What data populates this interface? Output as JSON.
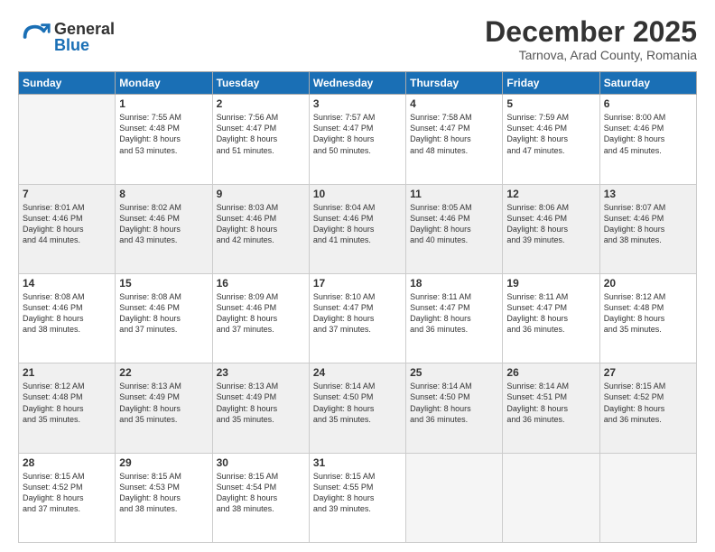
{
  "logo": {
    "general": "General",
    "blue": "Blue"
  },
  "title": "December 2025",
  "location": "Tarnova, Arad County, Romania",
  "weekdays": [
    "Sunday",
    "Monday",
    "Tuesday",
    "Wednesday",
    "Thursday",
    "Friday",
    "Saturday"
  ],
  "weeks": [
    [
      {
        "day": "",
        "empty": true
      },
      {
        "day": "1",
        "sunrise": "7:55 AM",
        "sunset": "4:48 PM",
        "daylight": "8 hours and 53 minutes."
      },
      {
        "day": "2",
        "sunrise": "7:56 AM",
        "sunset": "4:47 PM",
        "daylight": "8 hours and 51 minutes."
      },
      {
        "day": "3",
        "sunrise": "7:57 AM",
        "sunset": "4:47 PM",
        "daylight": "8 hours and 50 minutes."
      },
      {
        "day": "4",
        "sunrise": "7:58 AM",
        "sunset": "4:47 PM",
        "daylight": "8 hours and 48 minutes."
      },
      {
        "day": "5",
        "sunrise": "7:59 AM",
        "sunset": "4:46 PM",
        "daylight": "8 hours and 47 minutes."
      },
      {
        "day": "6",
        "sunrise": "8:00 AM",
        "sunset": "4:46 PM",
        "daylight": "8 hours and 45 minutes."
      }
    ],
    [
      {
        "day": "7",
        "sunrise": "8:01 AM",
        "sunset": "4:46 PM",
        "daylight": "8 hours and 44 minutes."
      },
      {
        "day": "8",
        "sunrise": "8:02 AM",
        "sunset": "4:46 PM",
        "daylight": "8 hours and 43 minutes."
      },
      {
        "day": "9",
        "sunrise": "8:03 AM",
        "sunset": "4:46 PM",
        "daylight": "8 hours and 42 minutes."
      },
      {
        "day": "10",
        "sunrise": "8:04 AM",
        "sunset": "4:46 PM",
        "daylight": "8 hours and 41 minutes."
      },
      {
        "day": "11",
        "sunrise": "8:05 AM",
        "sunset": "4:46 PM",
        "daylight": "8 hours and 40 minutes."
      },
      {
        "day": "12",
        "sunrise": "8:06 AM",
        "sunset": "4:46 PM",
        "daylight": "8 hours and 39 minutes."
      },
      {
        "day": "13",
        "sunrise": "8:07 AM",
        "sunset": "4:46 PM",
        "daylight": "8 hours and 38 minutes."
      }
    ],
    [
      {
        "day": "14",
        "sunrise": "8:08 AM",
        "sunset": "4:46 PM",
        "daylight": "8 hours and 38 minutes."
      },
      {
        "day": "15",
        "sunrise": "8:08 AM",
        "sunset": "4:46 PM",
        "daylight": "8 hours and 37 minutes."
      },
      {
        "day": "16",
        "sunrise": "8:09 AM",
        "sunset": "4:46 PM",
        "daylight": "8 hours and 37 minutes."
      },
      {
        "day": "17",
        "sunrise": "8:10 AM",
        "sunset": "4:47 PM",
        "daylight": "8 hours and 37 minutes."
      },
      {
        "day": "18",
        "sunrise": "8:11 AM",
        "sunset": "4:47 PM",
        "daylight": "8 hours and 36 minutes."
      },
      {
        "day": "19",
        "sunrise": "8:11 AM",
        "sunset": "4:47 PM",
        "daylight": "8 hours and 36 minutes."
      },
      {
        "day": "20",
        "sunrise": "8:12 AM",
        "sunset": "4:48 PM",
        "daylight": "8 hours and 35 minutes."
      }
    ],
    [
      {
        "day": "21",
        "sunrise": "8:12 AM",
        "sunset": "4:48 PM",
        "daylight": "8 hours and 35 minutes."
      },
      {
        "day": "22",
        "sunrise": "8:13 AM",
        "sunset": "4:49 PM",
        "daylight": "8 hours and 35 minutes."
      },
      {
        "day": "23",
        "sunrise": "8:13 AM",
        "sunset": "4:49 PM",
        "daylight": "8 hours and 35 minutes."
      },
      {
        "day": "24",
        "sunrise": "8:14 AM",
        "sunset": "4:50 PM",
        "daylight": "8 hours and 35 minutes."
      },
      {
        "day": "25",
        "sunrise": "8:14 AM",
        "sunset": "4:50 PM",
        "daylight": "8 hours and 36 minutes."
      },
      {
        "day": "26",
        "sunrise": "8:14 AM",
        "sunset": "4:51 PM",
        "daylight": "8 hours and 36 minutes."
      },
      {
        "day": "27",
        "sunrise": "8:15 AM",
        "sunset": "4:52 PM",
        "daylight": "8 hours and 36 minutes."
      }
    ],
    [
      {
        "day": "28",
        "sunrise": "8:15 AM",
        "sunset": "4:52 PM",
        "daylight": "8 hours and 37 minutes."
      },
      {
        "day": "29",
        "sunrise": "8:15 AM",
        "sunset": "4:53 PM",
        "daylight": "8 hours and 38 minutes."
      },
      {
        "day": "30",
        "sunrise": "8:15 AM",
        "sunset": "4:54 PM",
        "daylight": "8 hours and 38 minutes."
      },
      {
        "day": "31",
        "sunrise": "8:15 AM",
        "sunset": "4:55 PM",
        "daylight": "8 hours and 39 minutes."
      },
      {
        "day": "",
        "empty": true
      },
      {
        "day": "",
        "empty": true
      },
      {
        "day": "",
        "empty": true
      }
    ]
  ]
}
